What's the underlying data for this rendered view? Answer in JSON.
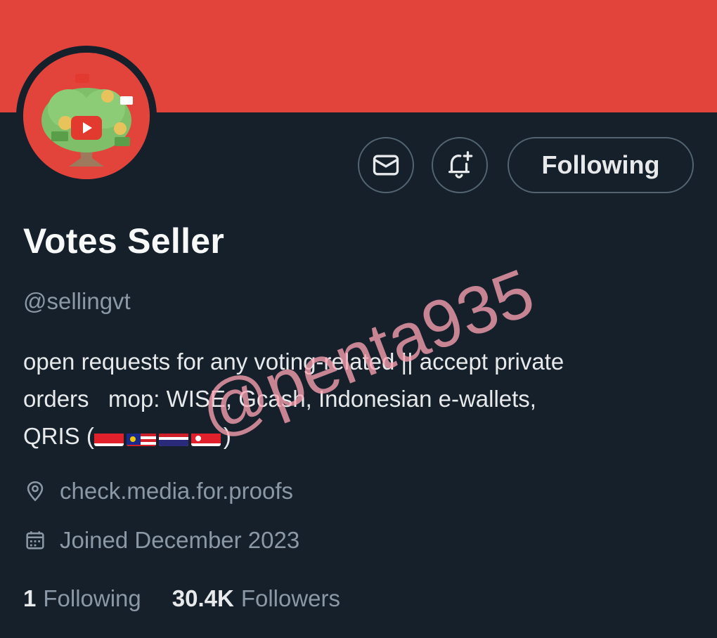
{
  "profile": {
    "display_name": "Votes Seller",
    "handle": "@sellingvt",
    "bio_line1": "open requests for any voting-related || accept private",
    "bio_line2": "orders   mop: WISE, Gcash, Indonesian e-wallets,",
    "bio_line3_prefix": "QRIS (",
    "bio_line3_suffix": ")",
    "bio_flags": [
      "flag-indonesia",
      "flag-malaysia",
      "flag-thailand",
      "flag-singapore"
    ],
    "location": "check.media.for.proofs",
    "joined": "Joined December 2023"
  },
  "actions": {
    "message_icon": "envelope-icon",
    "notify_icon": "bell-plus-icon",
    "follow_label": "Following"
  },
  "stats": {
    "following_count": "1",
    "following_label": "Following",
    "followers_count": "30.4K",
    "followers_label": "Followers"
  },
  "watermark": "@penta935",
  "colors": {
    "banner": "#e2443c",
    "background": "#15202b",
    "primary_text": "#e7e9ea",
    "secondary_text": "#8b98a5",
    "border": "#536471",
    "watermark": "#faa0af"
  }
}
